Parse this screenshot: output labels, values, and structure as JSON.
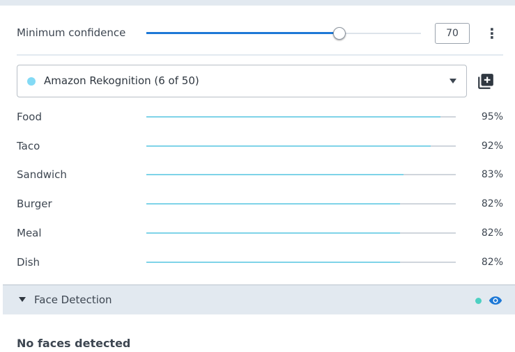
{
  "confidence": {
    "label": "Minimum confidence",
    "value": "70",
    "slider_fraction": 0.7
  },
  "provider": {
    "label": "Amazon Rekognition (6 of 50)",
    "dot_color": "#83daf5"
  },
  "labels": [
    {
      "name": "Food",
      "percent": "95%",
      "score": 0.95
    },
    {
      "name": "Taco",
      "percent": "92%",
      "score": 0.92
    },
    {
      "name": "Sandwich",
      "percent": "83%",
      "score": 0.83
    },
    {
      "name": "Burger",
      "percent": "82%",
      "score": 0.82
    },
    {
      "name": "Meal",
      "percent": "82%",
      "score": 0.82
    },
    {
      "name": "Dish",
      "percent": "82%",
      "score": 0.82
    }
  ],
  "face_detection": {
    "title": "Face Detection",
    "status_color": "#4dd0c2",
    "empty_message": "No faces detected"
  },
  "icons": {
    "menu": "more-vertical-icon",
    "add": "add-box-icon",
    "caret": "caret-down-icon",
    "visibility": "eye-icon"
  },
  "colors": {
    "accent": "#1d78d6",
    "label_bar": "#7ed3e8",
    "panel_header": "#e2e9f0"
  }
}
